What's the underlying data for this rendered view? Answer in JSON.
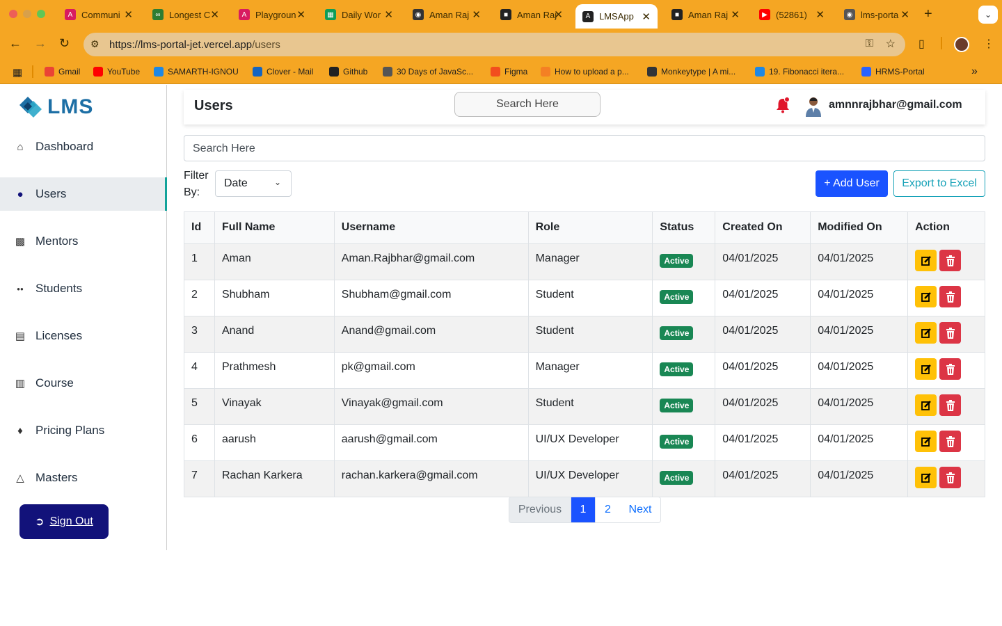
{
  "browser": {
    "tabs": [
      {
        "title": "Communi",
        "icon": "angular-icon",
        "color": "#d81b60"
      },
      {
        "title": "Longest C",
        "icon": "leetcode-icon",
        "color": "#2e7d32"
      },
      {
        "title": "Playgroun",
        "icon": "angular-icon",
        "color": "#d81b60"
      },
      {
        "title": "Daily Wor",
        "icon": "sheets-icon",
        "color": "#0f9d58"
      },
      {
        "title": "Aman Raj",
        "icon": "globe-icon",
        "color": "#333333"
      },
      {
        "title": "Aman Raj",
        "icon": "profile-icon",
        "color": "#222222"
      },
      {
        "title": "LMSApp",
        "icon": "angular-icon",
        "color": "#222222"
      },
      {
        "title": "Aman Raj",
        "icon": "profile-icon",
        "color": "#222222"
      },
      {
        "title": "(52861)",
        "icon": "youtube-icon",
        "color": "#ff0000"
      },
      {
        "title": "lms-porta",
        "icon": "globe-icon",
        "color": "#555555"
      }
    ],
    "active_tab_index": 6,
    "url_host": "https://lms-portal-jet.vercel.app",
    "url_path": "/users",
    "bookmarks": [
      {
        "label": "Gmail",
        "icon": "gmail-icon",
        "color": "#ea4335"
      },
      {
        "label": "YouTube",
        "icon": "youtube-icon",
        "color": "#ff0000"
      },
      {
        "label": "SAMARTH-IGNOU",
        "icon": "samarth-icon",
        "color": "#1e88e5"
      },
      {
        "label": "Clover - Mail",
        "icon": "clover-icon",
        "color": "#1565c0"
      },
      {
        "label": "Github",
        "icon": "github-icon",
        "color": "#222222"
      },
      {
        "label": "30 Days of JavaSc...",
        "icon": "js-icon",
        "color": "#555555"
      },
      {
        "label": "Figma",
        "icon": "figma-icon",
        "color": "#f24e1e"
      },
      {
        "label": "How to upload a p...",
        "icon": "stackoverflow-icon",
        "color": "#f48024"
      },
      {
        "label": "Monkeytype | A mi...",
        "icon": "monkeytype-icon",
        "color": "#323437"
      },
      {
        "label": "19. Fibonacci itera...",
        "icon": "fib-icon",
        "color": "#1e88e5"
      },
      {
        "label": "HRMS-Portal",
        "icon": "bolt-icon",
        "color": "#2962ff"
      }
    ]
  },
  "sidebar": {
    "logo_text": "LMS",
    "items": [
      {
        "label": "Dashboard",
        "icon": "home-icon"
      },
      {
        "label": "Users",
        "icon": "user-icon"
      },
      {
        "label": "Mentors",
        "icon": "mentors-icon"
      },
      {
        "label": "Students",
        "icon": "students-icon"
      },
      {
        "label": "Licenses",
        "icon": "license-icon"
      },
      {
        "label": "Course",
        "icon": "course-icon"
      },
      {
        "label": "Pricing Plans",
        "icon": "tags-icon"
      },
      {
        "label": "Masters",
        "icon": "graduation-cap-icon"
      }
    ],
    "active_index": 1,
    "signout_label": "Sign Out"
  },
  "header": {
    "title": "Users",
    "search_placeholder": "Search Here",
    "user_email": "amnnrajbhar@gmail.com"
  },
  "main": {
    "search_placeholder": "Search Here",
    "filter_label": "Filter By:",
    "filter_value": "Date",
    "add_user_label": "+ Add User",
    "export_label": "Export to Excel"
  },
  "table": {
    "columns": [
      "Id",
      "Full Name",
      "Username",
      "Role",
      "Status",
      "Created On",
      "Modified On",
      "Action"
    ],
    "rows": [
      {
        "id": "1",
        "full_name": "Aman",
        "username": "Aman.Rajbhar@gmail.com",
        "role": "Manager",
        "status": "Active",
        "created_on": "04/01/2025",
        "modified_on": "04/01/2025"
      },
      {
        "id": "2",
        "full_name": "Shubham",
        "username": "Shubham@gmail.com",
        "role": "Student",
        "status": "Active",
        "created_on": "04/01/2025",
        "modified_on": "04/01/2025"
      },
      {
        "id": "3",
        "full_name": "Anand",
        "username": "Anand@gmail.com",
        "role": "Student",
        "status": "Active",
        "created_on": "04/01/2025",
        "modified_on": "04/01/2025"
      },
      {
        "id": "4",
        "full_name": "Prathmesh",
        "username": "pk@gmail.com",
        "role": "Manager",
        "status": "Active",
        "created_on": "04/01/2025",
        "modified_on": "04/01/2025"
      },
      {
        "id": "5",
        "full_name": "Vinayak",
        "username": "Vinayak@gmail.com",
        "role": "Student",
        "status": "Active",
        "created_on": "04/01/2025",
        "modified_on": "04/01/2025"
      },
      {
        "id": "6",
        "full_name": "aarush",
        "username": "aarush@gmail.com",
        "role": "UI/UX Developer",
        "status": "Active",
        "created_on": "04/01/2025",
        "modified_on": "04/01/2025"
      },
      {
        "id": "7",
        "full_name": "Rachan Karkera",
        "username": "rachan.karkera@gmail.com",
        "role": "UI/UX Developer",
        "status": "Active",
        "created_on": "04/01/2025",
        "modified_on": "04/01/2025"
      }
    ]
  },
  "pagination": {
    "prev_label": "Previous",
    "pages": [
      "1",
      "2"
    ],
    "current_page": "1",
    "next_label": "Next"
  },
  "colors": {
    "browser_accent": "#f5a623",
    "primary": "#1a53ff",
    "sidebar_active_border": "#12a39a",
    "signout_bg": "#12127a",
    "status_active": "#198754",
    "edit_btn": "#ffc107",
    "delete_btn": "#dc3545",
    "export_border": "#17a2b8"
  }
}
